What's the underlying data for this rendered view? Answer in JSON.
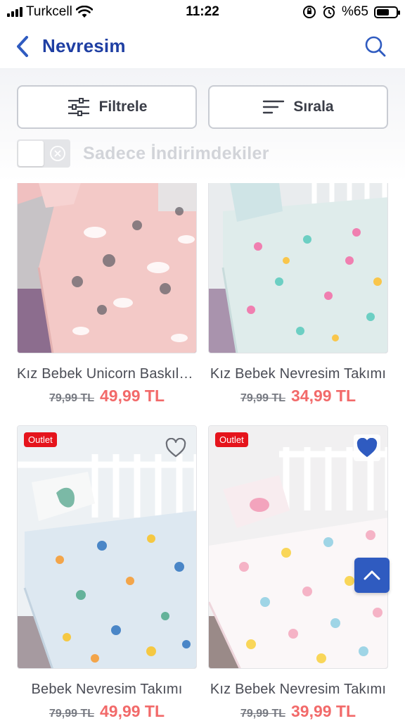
{
  "status_bar": {
    "carrier": "Turkcell",
    "time": "11:22",
    "battery": "%65",
    "battery_level": 0.65
  },
  "header": {
    "title": "Nevresim"
  },
  "filters": {
    "filter_label": "Filtrele",
    "sort_label": "Sırala",
    "discount_toggle_label": "Sadece İndirimdekiler",
    "discount_toggle_on": false
  },
  "products": [
    {
      "name": "Kız Bebek Unicorn Baskılı Nevresim Takımı",
      "old_price": "79,99 TL",
      "new_price": "49,99 TL",
      "badge": "",
      "favorite": null
    },
    {
      "name": "Kız Bebek Nevresim Takımı",
      "old_price": "79,99 TL",
      "new_price": "34,99 TL",
      "badge": "",
      "favorite": null
    },
    {
      "name": "Bebek Nevresim Takımı",
      "old_price": "79,99 TL",
      "new_price": "49,99 TL",
      "badge": "Outlet",
      "favorite": false
    },
    {
      "name": "Kız Bebek Nevresim Takımı",
      "old_price": "79,99 TL",
      "new_price": "39,99 TL",
      "badge": "Outlet",
      "favorite": true
    }
  ],
  "colors": {
    "brand_blue": "#1f3fa3",
    "price_red": "#f26a6a",
    "badge_red": "#e5141c",
    "favorite_blue": "#2f5bc0"
  },
  "icons": {
    "back": "chevron-left-icon",
    "search": "search-icon",
    "filter": "sliders-icon",
    "sort": "sort-lines-icon",
    "favorite": "heart-icon",
    "scroll_top": "chevron-up-icon"
  }
}
